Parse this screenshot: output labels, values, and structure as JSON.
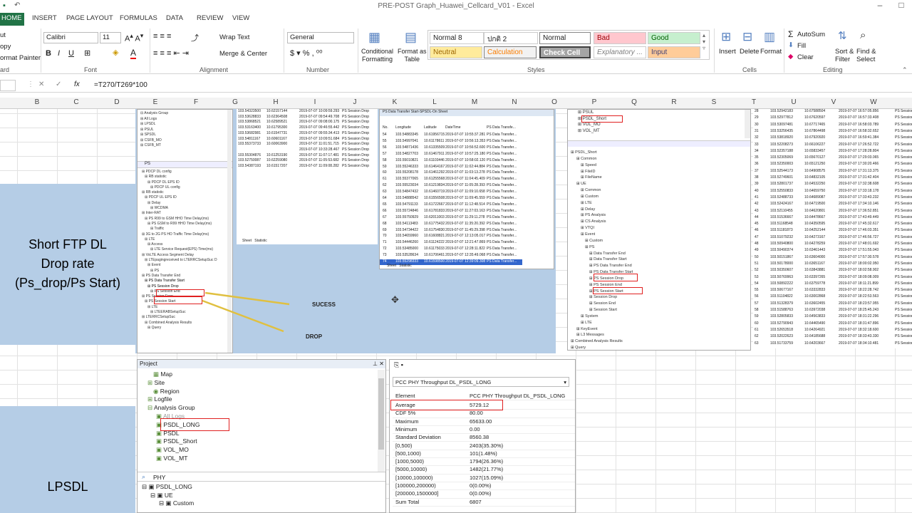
{
  "title": "PRE-POST Graph_Huawei_Cellcard_V01 - Excel",
  "ribbon_tabs": [
    "HOME",
    "INSERT",
    "PAGE LAYOUT",
    "FORMULAS",
    "DATA",
    "REVIEW",
    "VIEW"
  ],
  "ribbon": {
    "clipboard": {
      "cut": "ut",
      "copy": "opy",
      "format_painter": "ormat Painter",
      "label": "ard"
    },
    "font": {
      "name": "Calibri",
      "size": "11",
      "label": "Font"
    },
    "alignment": {
      "wrap": "Wrap Text",
      "merge": "Merge & Center",
      "label": "Alignment"
    },
    "number": {
      "format": "General",
      "label": "Number"
    },
    "styles": {
      "conditional": "Conditional\nFormatting",
      "format_as_table": "Format as\nTable",
      "cells": [
        {
          "label": "Normal 8",
          "bg": "#ffffff",
          "fg": "#000000"
        },
        {
          "label": "ปกติ 2",
          "bg": "#ffffff",
          "fg": "#000000"
        },
        {
          "label": "Normal",
          "bg": "#ffffff",
          "fg": "#000000"
        },
        {
          "label": "Bad",
          "bg": "#ffc7ce",
          "fg": "#9c0006"
        },
        {
          "label": "Good",
          "bg": "#c6efce",
          "fg": "#006100"
        },
        {
          "label": "Neutral",
          "bg": "#ffeb9c",
          "fg": "#9c6500"
        },
        {
          "label": "Calculation",
          "bg": "#f2f2f2",
          "fg": "#fa7d00"
        },
        {
          "label": "Check Cell",
          "bg": "#a5a5a5",
          "fg": "#ffffff"
        },
        {
          "label": "Explanatory ...",
          "bg": "#ffffff",
          "fg": "#7f7f7f"
        },
        {
          "label": "Input",
          "bg": "#ffcc99",
          "fg": "#3f3f76"
        }
      ],
      "label": "Styles"
    },
    "cells": {
      "insert": "Insert",
      "delete": "Delete",
      "format": "Format",
      "label": "Cells"
    },
    "editing": {
      "autosum": "AutoSum",
      "fill": "Fill",
      "clear": "Clear",
      "sort": "Sort &\nFilter",
      "find": "Find &\nSelect",
      "label": "Editing"
    }
  },
  "formula": {
    "name_box": "",
    "fx": "fx",
    "content": "=T270/T269*100"
  },
  "columns": [
    "B",
    "C",
    "D",
    "E",
    "F",
    "G",
    "H",
    "I",
    "J",
    "K",
    "L",
    "M",
    "N",
    "O",
    "P",
    "Q",
    "R",
    "S",
    "T",
    "U",
    "V",
    "W"
  ],
  "sheet_text": {
    "short_ftp": [
      "Short FTP DL",
      "Drop rate",
      "(Ps_drop/Ps Start)"
    ],
    "lpsdl": "LPSDL",
    "sucess": "SUCESS",
    "drop": "DROP"
  },
  "left_tree_top": [
    "Analysis Group",
    "All Logs",
    "LPSDL",
    "PSUL",
    "SPSDL",
    "CSFB_MO",
    "CSFB_MT"
  ],
  "left_tree_search": "PS",
  "left_tree_lower": [
    "PDCP DL config",
    "RB statistic",
    "PDCP DL EPS ID",
    "PDCP UL config",
    "RB statistic",
    "PDCP UL EPS ID",
    "Delay",
    "WCDMA",
    "Inter-RAT",
    "PS R99 to GSM HHO Time Delay(ms)",
    "PS GSM to R99 HHO Time Delay(ms)",
    "Traffic",
    "3G to 2G PS HO Traffic Time Delay(ms)",
    "LTE",
    "Access",
    "LTE Service Request(EPS) Time(ms)",
    "VoLTE Access Segment Delay",
    "LTEpagingreceived to LTERRCSetupSuc D",
    "Event",
    "PS",
    "PS Data Transfer End",
    "PS Data Transfer Start",
    "PS Session Drop",
    "PS Session End",
    "PS Session Error",
    "PS Session Start",
    "LTE",
    "LTEERABSetupSuc",
    "LTERRCSetupSuc",
    "Combined Analysis Results",
    "Query"
  ],
  "mid_table_rows": [
    [
      "103.54323500",
      "10.62157144",
      "2019-07-07 10:09:59.293",
      "PS Session Drop"
    ],
    [
      "103.53628833",
      "10.62364508",
      "2019-07-07 09:54:49.708",
      "PS Session Drop"
    ],
    [
      "103.53868521",
      "10.62589521",
      "2019-07-07 09:08:00.175",
      "PS Session Drop"
    ],
    [
      "103.53163400",
      "10.61795300",
      "2019-07-07 09:46:55.442",
      "PS Session Drop"
    ],
    [
      "103.53682981",
      "10.61547731",
      "2019-07-07 09:55:34.413",
      "PS Session Drop"
    ],
    [
      "103.54811167",
      "10.60601167",
      "2019-07-07 10:09:51.684",
      "PS Session Drop"
    ],
    [
      "103.55373733",
      "10.60063900",
      "2019-07-07 11:01:51.715",
      "PS Session Drop"
    ],
    [
      "",
      "",
      "2019-07-07 10:33:28.467",
      "PS Session Drop"
    ],
    [
      "103.55304876",
      "10.61253190",
      "2019-07-07 11:07:17.481",
      "PS Session Drop"
    ],
    [
      "103.52750087",
      "10.62259080",
      "2019-07-07 11:05:53.682",
      "PS Session Drop"
    ],
    [
      "103.54387193",
      "10.61517207",
      "2019-07-07 11:09:08.282",
      "PS Session Drop"
    ]
  ],
  "data_sheet": {
    "title": "PS Data Transfer Start-SPSDL-On Sheet",
    "headers": [
      "No.",
      "Longitude",
      "Latitude",
      "DateTime",
      "PS Data Transfe..."
    ],
    "rows": [
      [
        "54",
        "103.54883345",
        "10.61956715",
        "2019-07-07 10:55:37.281",
        "PS Data Transfer..."
      ],
      [
        "55",
        "103.54997041",
        "10.61178611",
        "2019-07-07 10:56:13.353",
        "PS Data Transfer..."
      ],
      [
        "56",
        "103.54871436",
        "10.61335509",
        "2019-07-07 10:56:52.600",
        "PS Data Transfer..."
      ],
      [
        "57",
        "103.54827703",
        "10.61467911",
        "2019-07-07 10:57:25.180",
        "PS Data Transfer..."
      ],
      [
        "58",
        "103.55010821",
        "10.61103446",
        "2019-07-07 10:58:02.120",
        "PS Data Transfer..."
      ],
      [
        "59",
        "103.55246333",
        "10.61464167",
        "2019-07-07 11:02:44.884",
        "PS Data Transfer..."
      ],
      [
        "60",
        "103.55208178",
        "10.61461292",
        "2019-07-07 11:03:13.278",
        "PS Data Transfer..."
      ],
      [
        "61",
        "103.55377065",
        "10.61255568",
        "2019-07-07 11:04:45.409",
        "PS Data Transfer..."
      ],
      [
        "62",
        "103.55523034",
        "10.61219834",
        "2019-07-07 11:05:28.393",
        "PS Data Transfer..."
      ],
      [
        "63",
        "103.54847432",
        "10.61460719",
        "2019-07-07 11:09:10.658",
        "PS Data Transfer..."
      ],
      [
        "64",
        "103.54888542",
        "10.61556508",
        "2019-07-07 11:09:45.559",
        "PS Data Transfer..."
      ],
      [
        "65",
        "103.54791133",
        "10.61722667",
        "2019-07-07 11:12:48.514",
        "PS Data Transfer..."
      ],
      [
        "66",
        "103.55724846",
        "10.61781833",
        "2019-07-07 11:27:03.163",
        "PS Data Transfer..."
      ],
      [
        "67",
        "103.55750929",
        "10.62011003",
        "2019-07-07 11:29:11.278",
        "PS Data Transfer..."
      ],
      [
        "68",
        "103.54113483",
        "10.61775432",
        "2019-07-07 11:35:20.392",
        "PS Data Transfer..."
      ],
      [
        "69",
        "103.54734422",
        "10.61754830",
        "2019-07-07 11:45:29.398",
        "PS Data Transfer..."
      ],
      [
        "70",
        "103.54659960",
        "10.61608821",
        "2019-07-07 12:13:05.017",
        "PS Data Transfer..."
      ],
      [
        "71",
        "103.54446260",
        "10.61124222",
        "2019-07-07 12:21:47.869",
        "PS Data Transfer..."
      ],
      [
        "72",
        "103.53485000",
        "10.61175033",
        "2019-07-07 12:28:11.822",
        "PS Data Transfer..."
      ],
      [
        "73",
        "103.53528634",
        "10.61706461",
        "2019-07-07 12:35:49.068",
        "PS Data Transfer..."
      ],
      [
        "74",
        "103.55298333",
        "10.61598500",
        "2019-07-07 12:39:09.308",
        "PS Data Transfer..."
      ]
    ],
    "tabs": [
      "Sheet",
      "Statistic"
    ]
  },
  "right_tree_top": [
    "PSUL",
    "PSDL_Short",
    "VOL_MO",
    "VOL_MT"
  ],
  "right_tree": [
    "PSDL_Short",
    "Common",
    "Speed",
    "FileID",
    "FileName",
    "UE",
    "Common",
    "Custom",
    "LTE",
    "Delay",
    "PS Analysis",
    "CS Analysis",
    "VTQI",
    "Event",
    "Custom",
    "PS",
    "Data Transfer End",
    "Data Transfer Start",
    "PS Data Transfer End",
    "PS Data Transfer Start",
    "PS Session Drop",
    "PS Session End",
    "PS Session Start",
    "Session Drop",
    "Session End",
    "Session Start",
    "System",
    "LTE",
    "KeyEvent",
    "L3 Messages",
    "Combined Analysis Results",
    "Query"
  ],
  "right_table_rows": [
    [
      "28",
      "103.52942183",
      "10.67588504",
      "2019-07-07 16:57:05.856",
      "PS Session"
    ],
    [
      "29",
      "103.52977812",
      "10.67620597",
      "2019-07-07 16:57:33.408",
      "PS Session"
    ],
    [
      "30",
      "103.53097481",
      "10.67717465",
      "2019-07-07 16:58:03.789",
      "PS Session"
    ],
    [
      "31",
      "103.53256435",
      "10.67864498",
      "2019-07-07 16:58:32.652",
      "PS Session"
    ],
    [
      "32",
      "103.53818920",
      "10.67920920",
      "2019-07-07 16:59:41.384",
      "PS Session"
    ],
    [
      "33",
      "103.52208273",
      "10.66106227",
      "2019-07-07 17:26:52.722",
      "PS Session"
    ],
    [
      "34",
      "103.52357188",
      "10.65833457",
      "2019-07-07 17:28:28.804",
      "PS Session"
    ],
    [
      "35",
      "103.52305069",
      "10.65670127",
      "2019-07-07 17:29:03.065",
      "PS Session"
    ],
    [
      "36",
      "103.52350003",
      "10.65121250",
      "2019-07-07 17:30:20.466",
      "PS Session"
    ],
    [
      "37",
      "103.52544173",
      "10.64908575",
      "2019-07-07 17:31:13.375",
      "PS Session"
    ],
    [
      "38",
      "103.52749601",
      "10.64832105",
      "2019-07-07 17:31:42.404",
      "PS Session"
    ],
    [
      "39",
      "103.52801737",
      "10.64532250",
      "2019-07-07 17:32:38.608",
      "PS Session"
    ],
    [
      "40",
      "103.52550833",
      "10.64659750",
      "2019-07-07 17:33:18.178",
      "PS Session"
    ],
    [
      "41",
      "103.52488733",
      "10.64689087",
      "2019-07-07 17:33:43.232",
      "PS Session"
    ],
    [
      "42",
      "103.52424167",
      "10.64719500",
      "2019-07-07 17:34:10.146",
      "PS Session"
    ],
    [
      "43",
      "103.52110455",
      "10.64620801",
      "2019-07-07 17:36:52.851",
      "PS Session"
    ],
    [
      "44",
      "103.51536667",
      "10.64478667",
      "2019-07-07 17:43:49.449",
      "PS Session"
    ],
    [
      "45",
      "103.51168548",
      "10.64350595",
      "2019-07-07 17:45:32.617",
      "PS Session"
    ],
    [
      "46",
      "103.51181873",
      "10.64252144",
      "2019-07-07 17:46:03.351",
      "PS Session"
    ],
    [
      "47",
      "103.51079232",
      "10.64273167",
      "2019-07-07 17:46:56.727",
      "PS Session"
    ],
    [
      "48",
      "103.50940800",
      "10.64278259",
      "2019-07-07 17:48:01.692",
      "PS Session"
    ],
    [
      "49",
      "103.50490374",
      "10.63461443",
      "2019-07-07 17:51:55.043",
      "PS Session"
    ],
    [
      "50",
      "103.50151867",
      "10.63604000",
      "2019-07-07 17:57:30.578",
      "PS Session"
    ],
    [
      "51",
      "103.50178000",
      "10.63651167",
      "2019-07-07 18:00:02.950",
      "PS Session"
    ],
    [
      "52",
      "103.50350607",
      "10.63843881",
      "2019-07-07 18:02:58.902",
      "PS Session"
    ],
    [
      "53",
      "103.50769963",
      "10.63397265",
      "2019-07-07 18:09:08.009",
      "PS Session"
    ],
    [
      "54",
      "103.50892222",
      "10.63759778",
      "2019-07-07 18:11:21.899",
      "PS Session"
    ],
    [
      "55",
      "103.50677167",
      "10.63332833",
      "2019-07-07 18:22:28.742",
      "PS Session"
    ],
    [
      "56",
      "103.51104822",
      "10.63002868",
      "2019-07-07 18:22:53.563",
      "PS Session"
    ],
    [
      "57",
      "103.51328379",
      "10.63602455",
      "2019-07-07 18:23:57.955",
      "PS Session"
    ],
    [
      "58",
      "103.51588763",
      "10.63972038",
      "2019-07-07 18:25:45.243",
      "PS Session"
    ],
    [
      "59",
      "103.52805833",
      "10.64563833",
      "2019-07-07 18:31:22.296",
      "PS Session"
    ],
    [
      "60",
      "103.52790943",
      "10.64465490",
      "2019-07-07 18:31:47.896",
      "PS Session"
    ],
    [
      "61",
      "103.52653518",
      "10.64264921",
      "2019-07-07 18:32:18.600",
      "PS Session"
    ],
    [
      "62",
      "103.52022623",
      "10.64185688",
      "2019-07-07 18:33:43.330",
      "PS Session"
    ],
    [
      "63",
      "103.51733759",
      "10.64203667",
      "2019-07-07 18:34:10.481",
      "PS Session"
    ]
  ],
  "project": {
    "title": "Project",
    "items": [
      "Map",
      "Site",
      "Region",
      "Logfile",
      "Analysis Group",
      "All Logs",
      "PSDL_LONG",
      "PSDL",
      "PSDL_Short",
      "VOL_MO",
      "VOL_MT"
    ],
    "search": "PHY",
    "search_tree": [
      "PSDL_LONG",
      "UE",
      "Custom"
    ]
  },
  "stats": {
    "dropdown": "PCC PHY Throughput DL_PSDL_LONG",
    "header": [
      "Element",
      "PCC PHY Throughput DL_PSDL_LONG"
    ],
    "rows": [
      [
        "Average",
        "5729.12"
      ],
      [
        "CDF 5%",
        "80.00"
      ],
      [
        "Maximum",
        "65633.00"
      ],
      [
        "Minimum",
        "0.00"
      ],
      [
        "Standard Deviation",
        "8560.38"
      ],
      [
        "[0,500)",
        "2403(35.30%)"
      ],
      [
        "[500,1000)",
        "101(1.48%)"
      ],
      [
        "[1000,5000)",
        "1794(26.36%)"
      ],
      [
        "[5000,10000)",
        "1482(21.77%)"
      ],
      [
        "[10000,100000)",
        "1027(15.09%)"
      ],
      [
        "[100000,200000)",
        "0(0.00%)"
      ],
      [
        "[200000,1500000]",
        "0(0.00%)"
      ],
      [
        "Sum Total",
        "6807"
      ]
    ]
  }
}
